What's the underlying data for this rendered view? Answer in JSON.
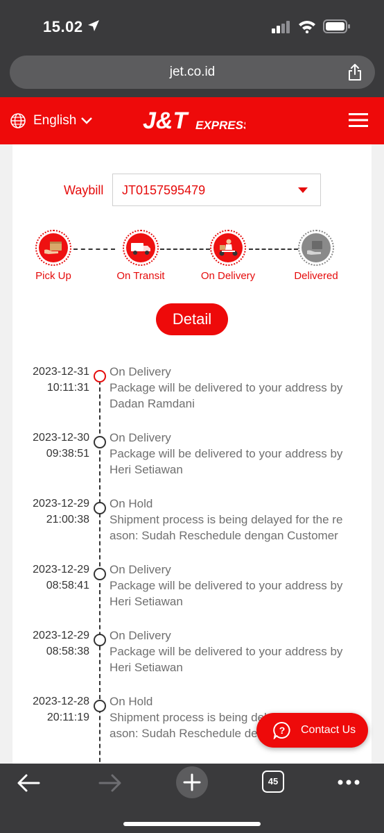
{
  "status_bar": {
    "time": "15.02"
  },
  "browser": {
    "url": "jet.co.id",
    "tab_count": "45"
  },
  "header": {
    "language": "English"
  },
  "waybill": {
    "label": "Waybill",
    "value": "JT0157595479"
  },
  "steps": [
    {
      "label": "Pick Up",
      "state": "active"
    },
    {
      "label": "On Transit",
      "state": "active"
    },
    {
      "label": "On Delivery",
      "state": "active"
    },
    {
      "label": "Delivered",
      "state": "inactive"
    }
  ],
  "detail_button": "Detail",
  "timeline": [
    {
      "date": "2023-12-31",
      "time": "10:11:31",
      "lines": [
        "On Delivery",
        "Package will be delivered to your address by",
        "Dadan Ramdani"
      ]
    },
    {
      "date": "2023-12-30",
      "time": "09:38:51",
      "lines": [
        "On Delivery",
        "Package will be delivered to your address by",
        "Heri Setiawan"
      ]
    },
    {
      "date": "2023-12-29",
      "time": "21:00:38",
      "lines": [
        "On Hold",
        "Shipment process is being delayed for the re",
        "ason: Sudah Reschedule dengan Customer"
      ]
    },
    {
      "date": "2023-12-29",
      "time": "08:58:41",
      "lines": [
        "On Delivery",
        "Package will be delivered to your address by",
        "Heri Setiawan"
      ]
    },
    {
      "date": "2023-12-29",
      "time": "08:58:38",
      "lines": [
        "On Delivery",
        "Package will be delivered to your address by",
        "Heri Setiawan"
      ]
    },
    {
      "date": "2023-12-28",
      "time": "20:11:19",
      "lines": [
        "On Hold",
        "Shipment process is being delayed for the re",
        "ason: Sudah Reschedule dengan Customer"
      ]
    }
  ],
  "contact_button": "Contact Us",
  "colors": {
    "brand_red": "#ee0a0a",
    "text_gray": "#6f6f6f",
    "chrome_dark": "#3a3a3c"
  }
}
